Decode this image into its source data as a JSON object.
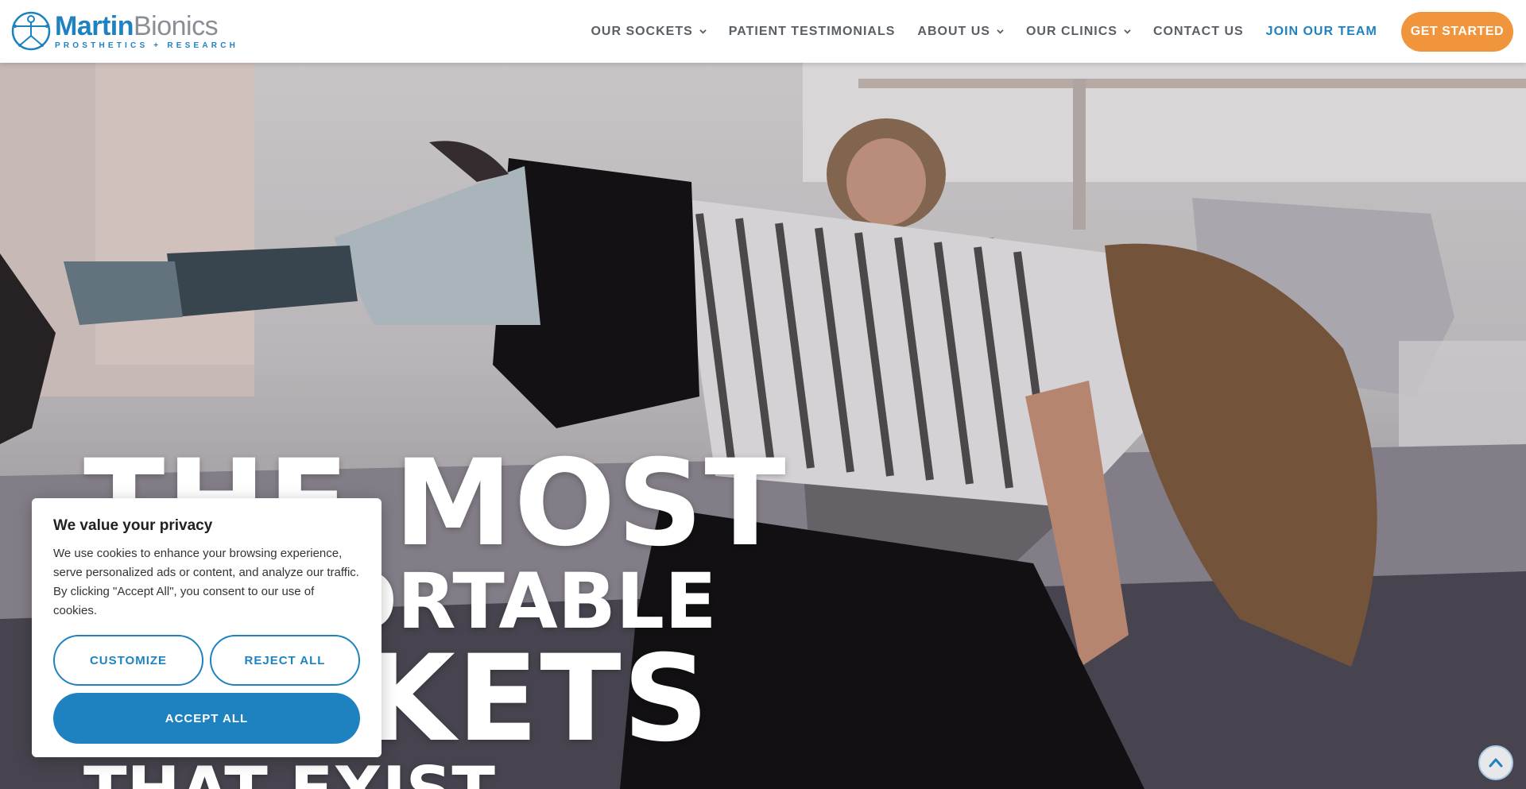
{
  "brand": {
    "name_part1": "Martin",
    "name_part2": "Bionics",
    "tagline": "PROSTHETICS + RESEARCH",
    "primary_color": "#1f82c0",
    "accent_color": "#f0953b"
  },
  "nav": {
    "items": [
      {
        "label": "OUR SOCKETS",
        "dropdown": true
      },
      {
        "label": "PATIENT TESTIMONIALS",
        "dropdown": false
      },
      {
        "label": "ABOUT US",
        "dropdown": true
      },
      {
        "label": "OUR CLINICS",
        "dropdown": true
      },
      {
        "label": "CONTACT US",
        "dropdown": false
      },
      {
        "label": "JOIN OUR TEAM",
        "dropdown": false
      }
    ],
    "cta_label": "GET STARTED"
  },
  "hero": {
    "line1": "THE MOST",
    "line2": "COMFORTABLE",
    "line3": "SOCKETS",
    "line4": "THAT EXIST"
  },
  "cookie": {
    "title": "We value your privacy",
    "body": "We use cookies to enhance your browsing experience, serve personalized ads or content, and analyze our traffic. By clicking \"Accept All\", you consent to our use of cookies.",
    "customize_label": "CUSTOMIZE",
    "reject_label": "REJECT ALL",
    "accept_label": "ACCEPT ALL"
  },
  "icons": {
    "dropdown": "chevron-down-icon",
    "scroll_top": "chevron-up-icon"
  }
}
